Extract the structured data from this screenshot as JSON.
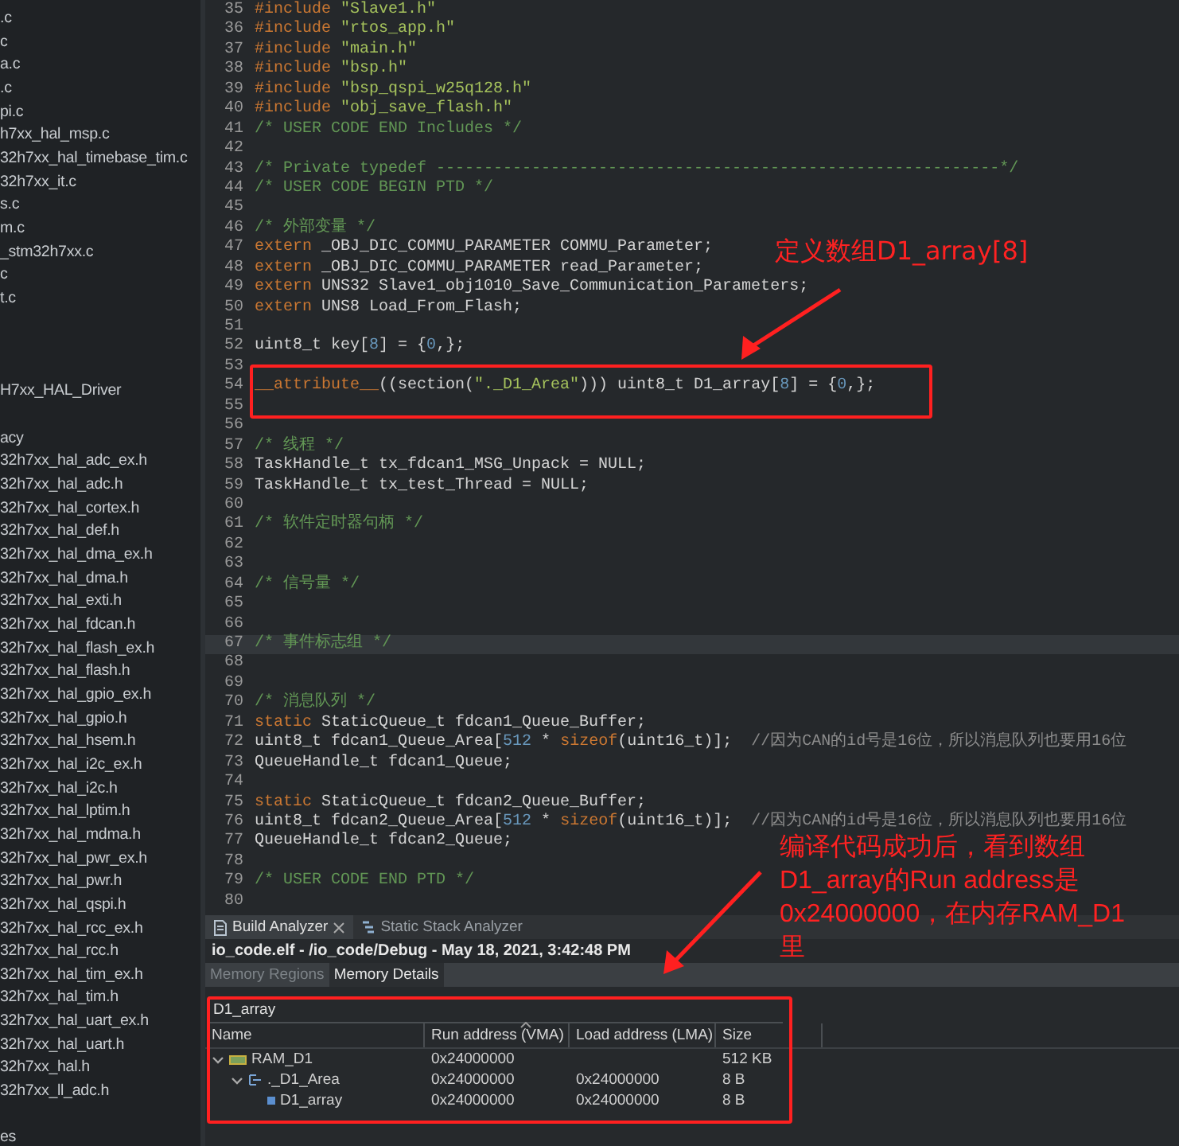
{
  "sidebar": {
    "groups": [
      {
        "items": [
          ".c",
          "c",
          "a.c",
          ".c",
          "pi.c",
          "h7xx_hal_msp.c",
          "32h7xx_hal_timebase_tim.c",
          "32h7xx_it.c",
          "s.c",
          "m.c",
          "_stm32h7xx.c",
          "c",
          "t.c"
        ]
      },
      {
        "items": [
          "H7xx_HAL_Driver"
        ]
      },
      {
        "items": [
          "acy",
          "32h7xx_hal_adc_ex.h",
          "32h7xx_hal_adc.h",
          "32h7xx_hal_cortex.h",
          "32h7xx_hal_def.h",
          "32h7xx_hal_dma_ex.h",
          "32h7xx_hal_dma.h",
          "32h7xx_hal_exti.h",
          "32h7xx_hal_fdcan.h",
          "32h7xx_hal_flash_ex.h",
          "32h7xx_hal_flash.h",
          "32h7xx_hal_gpio_ex.h",
          "32h7xx_hal_gpio.h",
          "32h7xx_hal_hsem.h",
          "32h7xx_hal_i2c_ex.h",
          "32h7xx_hal_i2c.h",
          "32h7xx_hal_lptim.h",
          "32h7xx_hal_mdma.h",
          "32h7xx_hal_pwr_ex.h",
          "32h7xx_hal_pwr.h",
          "32h7xx_hal_qspi.h",
          "32h7xx_hal_rcc_ex.h",
          "32h7xx_hal_rcc.h",
          "32h7xx_hal_tim_ex.h",
          "32h7xx_hal_tim.h",
          "32h7xx_hal_uart_ex.h",
          "32h7xx_hal_uart.h",
          "32h7xx_hal.h",
          "32h7xx_ll_adc.h"
        ]
      },
      {
        "items": [
          "es"
        ]
      }
    ]
  },
  "editor": {
    "lines": [
      {
        "n": "35",
        "current": false,
        "tokens": [
          {
            "kind": "kw",
            "text": "#include "
          },
          {
            "kind": "str",
            "text": "\"Slave1.h\""
          }
        ]
      },
      {
        "n": "36",
        "current": false,
        "tokens": [
          {
            "kind": "kw",
            "text": "#include "
          },
          {
            "kind": "str",
            "text": "\"rtos_app.h\""
          }
        ]
      },
      {
        "n": "37",
        "current": false,
        "tokens": [
          {
            "kind": "kw",
            "text": "#include "
          },
          {
            "kind": "str",
            "text": "\"main.h\""
          }
        ]
      },
      {
        "n": "38",
        "current": false,
        "tokens": [
          {
            "kind": "kw",
            "text": "#include "
          },
          {
            "kind": "str",
            "text": "\"bsp.h\""
          }
        ]
      },
      {
        "n": "39",
        "current": false,
        "tokens": [
          {
            "kind": "kw",
            "text": "#include "
          },
          {
            "kind": "str",
            "text": "\"bsp_qspi_w25q128.h\""
          }
        ]
      },
      {
        "n": "40",
        "current": false,
        "tokens": [
          {
            "kind": "kw",
            "text": "#include "
          },
          {
            "kind": "str",
            "text": "\"obj_save_flash.h\""
          }
        ]
      },
      {
        "n": "41",
        "current": false,
        "tokens": [
          {
            "kind": "com",
            "text": "/* USER CODE END Includes */"
          }
        ]
      },
      {
        "n": "42",
        "current": false
      },
      {
        "n": "43",
        "current": false,
        "tokens": [
          {
            "kind": "com",
            "text": "/* Private typedef -----------------------------------------------------------*/"
          }
        ]
      },
      {
        "n": "44",
        "current": false,
        "tokens": [
          {
            "kind": "com",
            "text": "/* USER CODE BEGIN PTD */"
          }
        ]
      },
      {
        "n": "45",
        "current": false
      },
      {
        "n": "46",
        "current": false,
        "tokens": [
          {
            "kind": "com",
            "text": "/* 外部变量 */"
          }
        ]
      },
      {
        "n": "47",
        "current": false,
        "tokens": [
          {
            "kind": "kw",
            "text": "extern"
          },
          {
            "kind": "plain",
            "text": " _OBJ_DIC_COMMU_PARAMETER COMMU_Parameter;"
          }
        ]
      },
      {
        "n": "48",
        "current": false,
        "tokens": [
          {
            "kind": "kw",
            "text": "extern"
          },
          {
            "kind": "plain",
            "text": " _OBJ_DIC_COMMU_PARAMETER read_Parameter;"
          }
        ]
      },
      {
        "n": "49",
        "current": false,
        "tokens": [
          {
            "kind": "kw",
            "text": "extern"
          },
          {
            "kind": "plain",
            "text": " UNS32 Slave1_obj1010_Save_Communication_Parameters;"
          }
        ]
      },
      {
        "n": "50",
        "current": false,
        "tokens": [
          {
            "kind": "kw",
            "text": "extern"
          },
          {
            "kind": "plain",
            "text": " UNS8 Load_From_Flash;"
          }
        ]
      },
      {
        "n": "51",
        "current": false
      },
      {
        "n": "52",
        "current": false,
        "tokens": [
          {
            "kind": "plain",
            "text": "uint8_t key["
          },
          {
            "kind": "num",
            "text": "8"
          },
          {
            "kind": "plain",
            "text": "] = {"
          },
          {
            "kind": "num",
            "text": "0"
          },
          {
            "kind": "plain",
            "text": ",};"
          }
        ]
      },
      {
        "n": "53",
        "current": false
      },
      {
        "n": "54",
        "current": false,
        "tokens": [
          {
            "kind": "kw",
            "text": "__attribute__"
          },
          {
            "kind": "plain",
            "text": "((section("
          },
          {
            "kind": "str",
            "text": "\"._D1_Area\""
          },
          {
            "kind": "plain",
            "text": "))) uint8_t D1_array["
          },
          {
            "kind": "num",
            "text": "8"
          },
          {
            "kind": "plain",
            "text": "] = {"
          },
          {
            "kind": "num",
            "text": "0"
          },
          {
            "kind": "plain",
            "text": ",};"
          }
        ]
      },
      {
        "n": "55",
        "current": false
      },
      {
        "n": "56",
        "current": false
      },
      {
        "n": "57",
        "current": false,
        "tokens": [
          {
            "kind": "com",
            "text": "/* 线程 */"
          }
        ]
      },
      {
        "n": "58",
        "current": false,
        "tokens": [
          {
            "kind": "plain",
            "text": "TaskHandle_t tx_fdcan1_MSG_Unpack = NULL;"
          }
        ]
      },
      {
        "n": "59",
        "current": false,
        "tokens": [
          {
            "kind": "plain",
            "text": "TaskHandle_t tx_test_Thread = NULL;"
          }
        ]
      },
      {
        "n": "60",
        "current": false
      },
      {
        "n": "61",
        "current": false,
        "tokens": [
          {
            "kind": "com",
            "text": "/* 软件定时器句柄 */"
          }
        ]
      },
      {
        "n": "62",
        "current": false
      },
      {
        "n": "63",
        "current": false
      },
      {
        "n": "64",
        "current": false,
        "tokens": [
          {
            "kind": "com",
            "text": "/* 信号量 */"
          }
        ]
      },
      {
        "n": "65",
        "current": false
      },
      {
        "n": "66",
        "current": false
      },
      {
        "n": "67",
        "current": true,
        "tokens": [
          {
            "kind": "com",
            "text": "/* 事件标志组 */"
          }
        ]
      },
      {
        "n": "68",
        "current": false
      },
      {
        "n": "69",
        "current": false
      },
      {
        "n": "70",
        "current": false,
        "tokens": [
          {
            "kind": "com",
            "text": "/* 消息队列 */"
          }
        ]
      },
      {
        "n": "71",
        "current": false,
        "tokens": [
          {
            "kind": "kw",
            "text": "static"
          },
          {
            "kind": "plain",
            "text": " StaticQueue_t fdcan1_Queue_Buffer;"
          }
        ]
      },
      {
        "n": "72",
        "current": false,
        "tokens": [
          {
            "kind": "plain",
            "text": "uint8_t fdcan1_Queue_Area["
          },
          {
            "kind": "num",
            "text": "512"
          },
          {
            "kind": "plain",
            "text": " * "
          },
          {
            "kind": "kw",
            "text": "sizeof"
          },
          {
            "kind": "plain",
            "text": "(uint16_t)];  "
          },
          {
            "kind": "lcom",
            "text": "//因为CAN的id号是16位，所以消息队列也要用16位"
          }
        ]
      },
      {
        "n": "73",
        "current": false,
        "tokens": [
          {
            "kind": "plain",
            "text": "QueueHandle_t fdcan1_Queue;"
          }
        ]
      },
      {
        "n": "74",
        "current": false
      },
      {
        "n": "75",
        "current": false,
        "tokens": [
          {
            "kind": "kw",
            "text": "static"
          },
          {
            "kind": "plain",
            "text": " StaticQueue_t fdcan2_Queue_Buffer;"
          }
        ]
      },
      {
        "n": "76",
        "current": false,
        "tokens": [
          {
            "kind": "plain",
            "text": "uint8_t fdcan2_Queue_Area["
          },
          {
            "kind": "num",
            "text": "512"
          },
          {
            "kind": "plain",
            "text": " * "
          },
          {
            "kind": "kw",
            "text": "sizeof"
          },
          {
            "kind": "plain",
            "text": "(uint16_t)];  "
          },
          {
            "kind": "lcom",
            "text": "//因为CAN的id号是16位，所以消息队列也要用16位"
          }
        ]
      },
      {
        "n": "77",
        "current": false,
        "tokens": [
          {
            "kind": "plain",
            "text": "QueueHandle_t fdcan2_Queue;"
          }
        ]
      },
      {
        "n": "78",
        "current": false
      },
      {
        "n": "79",
        "current": false,
        "tokens": [
          {
            "kind": "com",
            "text": "/* USER CODE END PTD */"
          }
        ]
      },
      {
        "n": "80",
        "current": false
      }
    ]
  },
  "panel": {
    "tabs": [
      {
        "label": "Build Analyzer",
        "selected": true
      },
      {
        "label": "Static Stack Analyzer",
        "selected": false
      }
    ],
    "title": "io_code.elf - /io_code/Debug - May 18, 2021, 3:42:48 PM",
    "subtabs": [
      {
        "label": "Memory Regions",
        "selected": false
      },
      {
        "label": "Memory Details",
        "selected": true
      }
    ],
    "filter": {
      "value": "D1_array"
    },
    "table": {
      "columns": [
        "Name",
        "Run address (VMA)",
        "Load address (LMA)",
        "Size"
      ],
      "rows": [
        {
          "kind": "region",
          "name": "RAM_D1",
          "run": "0x24000000",
          "size": "512 KB",
          "expanded": true,
          "children": [
            {
              "kind": "section",
              "name": "._D1_Area",
              "run": "0x24000000",
              "load": "0x24000000",
              "size": "8 B",
              "expanded": true,
              "children": [
                {
                  "kind": "symbol",
                  "name": "D1_array",
                  "run": "0x24000000",
                  "load": "0x24000000",
                  "size": "8 B"
                }
              ]
            }
          ]
        }
      ]
    }
  },
  "annotations": [
    {
      "text": "定义数组D1_array[8]"
    },
    {
      "text": "编译代码成功后，看到数组D1_array的Run address是0x24000000，在内存RAM_D1里"
    }
  ]
}
